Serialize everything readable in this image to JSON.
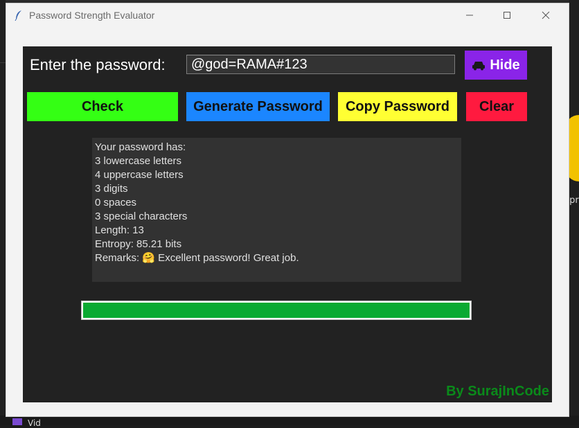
{
  "window": {
    "title": "Password Strength Evaluator"
  },
  "form": {
    "label": "Enter the password:",
    "password_value": "@god=RAMA#123",
    "hide_label": "Hide"
  },
  "buttons": {
    "check": "Check",
    "generate": "Generate Password",
    "copy": "Copy Password",
    "clear": "Clear"
  },
  "result": {
    "lines": [
      "Your password has:",
      "3 lowercase letters",
      "4 uppercase letters",
      "3 digits",
      "0 spaces",
      "3 special characters",
      "Length: 13",
      "Entropy: 85.21 bits",
      "Remarks: 🤗 Excellent password! Great job."
    ]
  },
  "progress": {
    "fraction": 1.0,
    "color": "#0aaa32"
  },
  "credit": "By SurajInCode",
  "background": {
    "taskbar_text": "Vid",
    "side_text": ".pr"
  },
  "colors": {
    "check": "#34ff14",
    "generate": "#1b86ff",
    "copy": "#ffff33",
    "clear": "#ff1a3f",
    "hide": "#8a24e8",
    "credit": "#0a8a1a"
  }
}
